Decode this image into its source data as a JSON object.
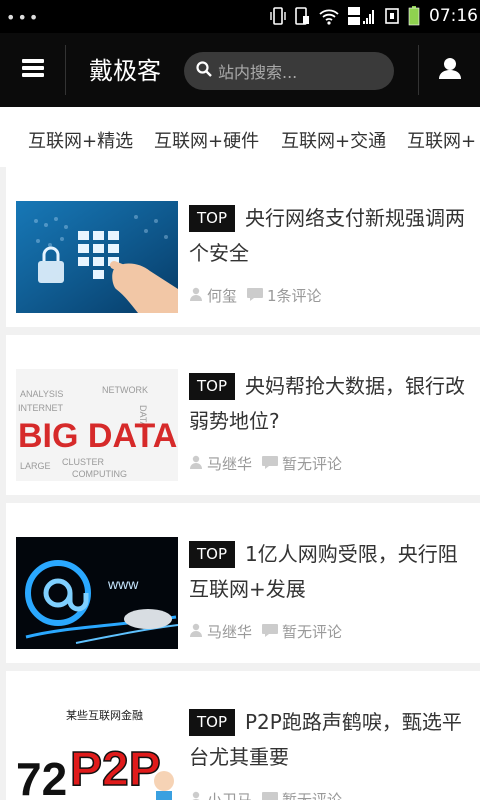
{
  "status_bar": {
    "time": "07:16",
    "icons": [
      "vibrate-icon",
      "sim-icon",
      "wifi-icon",
      "signal-3g-2g-icon",
      "notification-icon",
      "battery-icon"
    ]
  },
  "header": {
    "menu_icon": "hamburger-icon",
    "title": "戴极客",
    "search_placeholder": "站内搜索...",
    "user_icon": "user-icon"
  },
  "tabs": [
    {
      "label": "互联网+精选"
    },
    {
      "label": "互联网+硬件"
    },
    {
      "label": "互联网+交通"
    },
    {
      "label": "互联网+"
    }
  ],
  "articles": [
    {
      "badge": "TOP",
      "title": "央行网络支付新规强调两个安全",
      "author": "何玺",
      "comments": "1条评论",
      "thumb": "keypad-finger-image"
    },
    {
      "badge": "TOP",
      "title": "央妈帮抢大数据，银行改弱势地位?",
      "author": "马继华",
      "comments": "暂无评论",
      "thumb": "big-data-wordcloud-image",
      "thumb_text": "BIG DATA"
    },
    {
      "badge": "TOP",
      "title": "1亿人网购受限，央行阻互联网+发展",
      "author": "马继华",
      "comments": "暂无评论",
      "thumb": "glowing-at-sign-image"
    },
    {
      "badge": "TOP",
      "title": "P2P跑路声鹤唳，甄选平台尤其重要",
      "author": "小卫马",
      "comments": "暂无评论",
      "thumb": "p2p-cartoon-image",
      "thumb_text": "某些互联网金融"
    }
  ],
  "colors": {
    "header_bg": "#0b0b0b",
    "badge_bg": "#111111",
    "page_bg": "#f1f1f1"
  }
}
